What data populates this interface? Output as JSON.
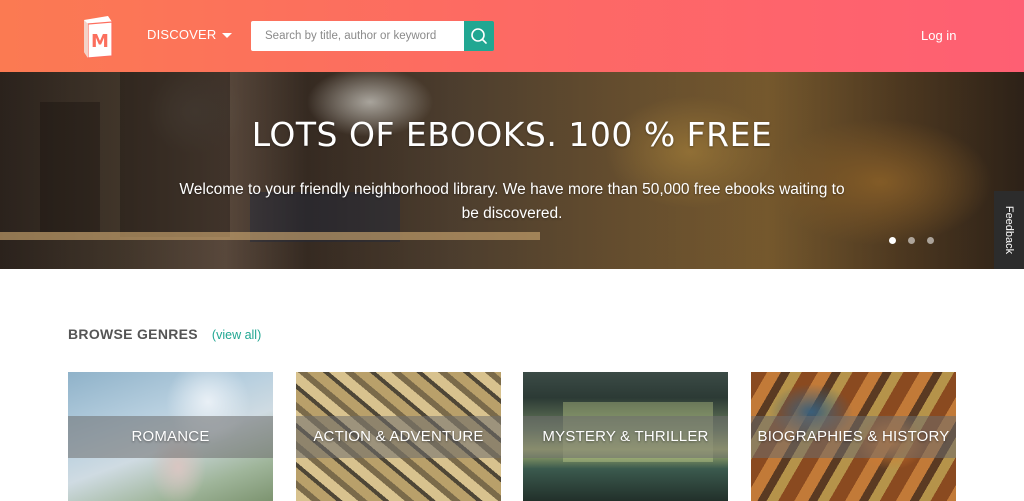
{
  "colors": {
    "header_start": "#fb7a52",
    "header_end": "#fe5f73",
    "accent": "#21a792"
  },
  "header": {
    "logo_letter": "M",
    "discover_label": "DISCOVER",
    "search": {
      "placeholder": "Search by title, author or keyword",
      "value": "",
      "icon": "search-icon"
    },
    "login_label": "Log in"
  },
  "hero": {
    "title": "LOTS OF EBOOKS. 100 % FREE",
    "subtitle": "Welcome to your friendly neighborhood library. We have more than 50,000 free ebooks waiting to be discovered.",
    "carousel_active_index": 0,
    "carousel_count": 3
  },
  "feedback_label": "Feedback",
  "genres": {
    "title": "BROWSE GENRES",
    "view_all": "(view all)",
    "items": [
      {
        "label": "ROMANCE"
      },
      {
        "label": "ACTION & ADVENTURE"
      },
      {
        "label": "MYSTERY & THRILLER"
      },
      {
        "label": "BIOGRAPHIES & HISTORY"
      }
    ]
  }
}
